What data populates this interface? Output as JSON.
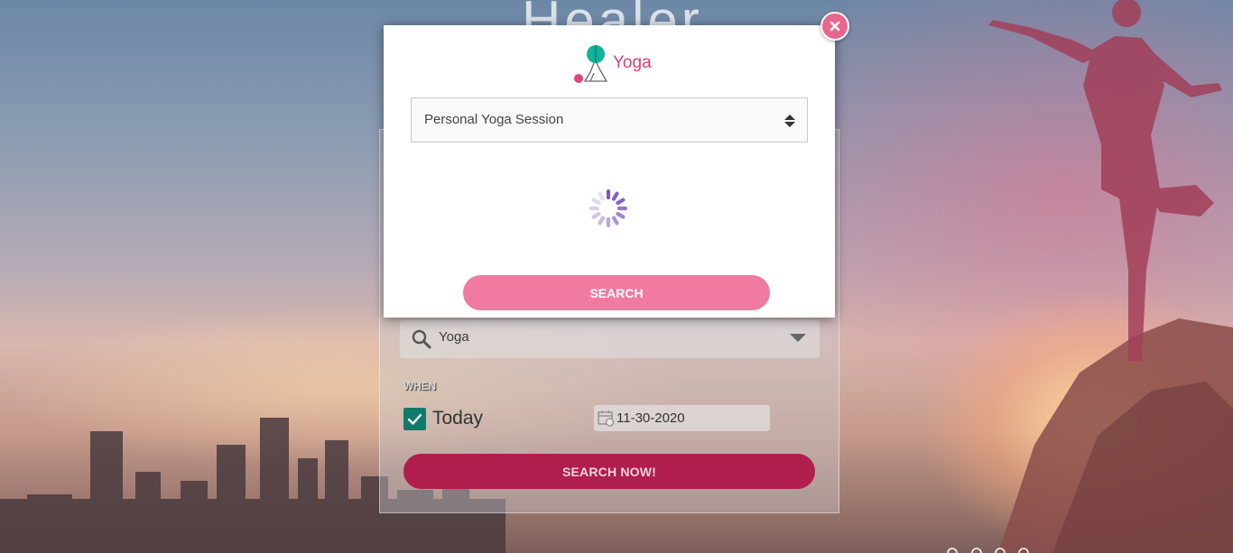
{
  "background": {
    "title_fragment": "Healer"
  },
  "search_panel": {
    "category_value": "Yoga",
    "when_label": "WHEN",
    "today_label": "Today",
    "today_checked": true,
    "date_value": "11-30-2020",
    "search_now_label": "SEARCH NOW!"
  },
  "modal": {
    "brand": "Yoga",
    "session_select_value": "Personal Yoga Session",
    "search_label": "SEARCH",
    "loading": true
  },
  "colors": {
    "accent_pink": "#f07aa0",
    "brand_pink": "#d83c77",
    "crimson": "#b01e4e",
    "check_green": "#117a6b"
  },
  "icons": {
    "close": "close-icon",
    "search": "search-icon",
    "calendar": "calendar-icon",
    "select_arrows": "updown-arrows-icon",
    "spinner": "loading-spinner-icon"
  }
}
